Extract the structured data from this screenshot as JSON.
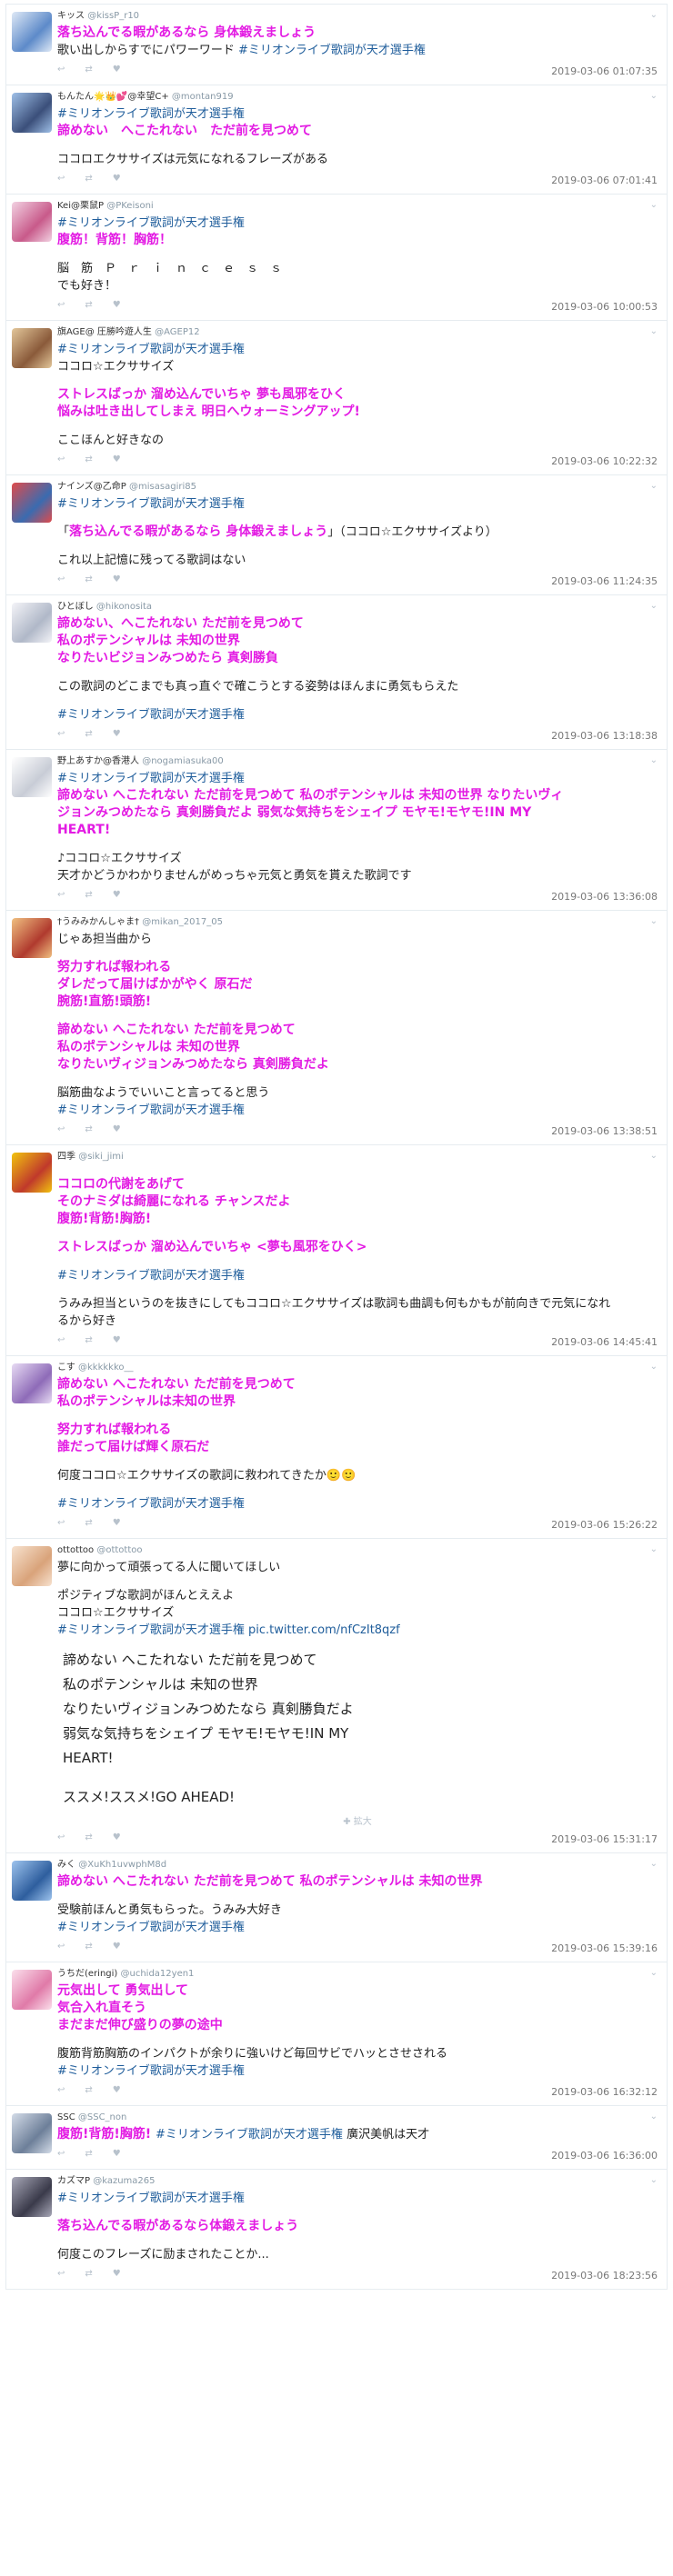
{
  "tweets": [
    {
      "name": "キッス",
      "handle": "@kissP_r10",
      "time": "2019-03-06 01:07:35",
      "avatar": "#5d8ac9",
      "avatar2": "#dfe9f6",
      "lines": [
        {
          "t": "落ち込んでる暇があるなら 身体鍛えましょう",
          "s": "b"
        },
        {
          "segs": [
            {
              "t": "歌い出しからすでにパワーワード ",
              "s": ""
            },
            {
              "t": "#ミリオンライブ歌詞が天才選手権",
              "s": "h"
            }
          ]
        }
      ]
    },
    {
      "name": "もんたん🌟👑💕@幸望C+",
      "handle": "@montan919",
      "time": "2019-03-06 07:01:41",
      "avatar": "#3b4f7a",
      "avatar2": "#9fc0e8",
      "lines": [
        {
          "t": "#ミリオンライブ歌詞が天才選手権",
          "s": "h"
        },
        {
          "t": "諦めない　へこたれない　ただ前を見つめて",
          "s": "b"
        },
        {
          "t": "",
          "s": "gap"
        },
        {
          "t": "ココロエクササイズは元気になれるフレーズがある",
          "s": ""
        }
      ]
    },
    {
      "name": "Kei@栗鼠P",
      "handle": "@PKeisoni",
      "time": "2019-03-06 10:00:53",
      "avatar": "#c85a8a",
      "avatar2": "#f2d2e2",
      "lines": [
        {
          "t": "#ミリオンライブ歌詞が天才選手権",
          "s": "h"
        },
        {
          "t": "腹筋！背筋！胸筋！",
          "s": "b"
        },
        {
          "t": "",
          "s": "gap"
        },
        {
          "t": "脳　筋　Ｐ　ｒ　ｉ　ｎ　ｃ　ｅ　ｓ　ｓ",
          "s": ""
        },
        {
          "t": "でも好き！",
          "s": ""
        }
      ]
    },
    {
      "name": "旗AGE@ 圧勝吟遊人生",
      "handle": "@AGEP12",
      "time": "2019-03-06 10:22:32",
      "avatar": "#8a5a3a",
      "avatar2": "#e3c79a",
      "lines": [
        {
          "t": "#ミリオンライブ歌詞が天才選手権",
          "s": "h"
        },
        {
          "t": "ココロ☆エクササイズ",
          "s": ""
        },
        {
          "t": "",
          "s": "gap"
        },
        {
          "t": "ストレスばっか 溜め込んでいちゃ 夢も風邪をひく",
          "s": "b"
        },
        {
          "t": "悩みは吐き出してしまえ 明日へウォーミングアップ!",
          "s": "b"
        },
        {
          "t": "",
          "s": "gap"
        },
        {
          "t": "ここほんと好きなの",
          "s": ""
        }
      ]
    },
    {
      "name": "ナインズ@乙命P",
      "handle": "@misasagiri85",
      "time": "2019-03-06 11:24:35",
      "avatar": "#3a6bb0",
      "avatar2": "#e04b4b",
      "lines": [
        {
          "t": "#ミリオンライブ歌詞が天才選手権",
          "s": "h"
        },
        {
          "t": "",
          "s": "gap"
        },
        {
          "segs": [
            {
              "t": "「",
              "s": ""
            },
            {
              "t": "落ち込んでる暇があるなら 身体鍛えましょう",
              "s": "b"
            },
            {
              "t": "」（ココロ☆エクササイズより）",
              "s": ""
            }
          ]
        },
        {
          "t": "",
          "s": "gap"
        },
        {
          "t": "これ以上記憶に残ってる歌詞はない",
          "s": ""
        }
      ]
    },
    {
      "name": "ひとぼし",
      "handle": "@hikonosita",
      "time": "2019-03-06 13:18:38",
      "avatar": "#b0b8c8",
      "avatar2": "#f4f4f8",
      "lines": [
        {
          "t": "諦めない、へこたれない ただ前を見つめて",
          "s": "b"
        },
        {
          "t": "私のポテンシャルは 未知の世界",
          "s": "b"
        },
        {
          "t": "なりたいビジョンみつめたら 真剣勝負",
          "s": "b"
        },
        {
          "t": "",
          "s": "gap"
        },
        {
          "t": "この歌詞のどこまでも真っ直ぐで確こうとする姿勢はほんまに勇気もらえた",
          "s": ""
        },
        {
          "t": "",
          "s": "gap"
        },
        {
          "t": " #ミリオンライブ歌詞が天才選手権",
          "s": "h"
        }
      ]
    },
    {
      "name": "野上あすか@香港人",
      "handle": "@nogamiasuka00",
      "time": "2019-03-06 13:36:08",
      "avatar": "#c8ccd6",
      "avatar2": "#ffffff",
      "lines": [
        {
          "t": "#ミリオンライブ歌詞が天才選手権",
          "s": "h"
        },
        {
          "t": "諦めない へこたれない ただ前を見つめて 私のポテンシャルは 未知の世界 なりたいヴィ",
          "s": "b"
        },
        {
          "t": "ジョンみつめたなら 真剣勝負だよ 弱気な気持ちをシェイプ モヤモ!モヤモ!IN MY",
          "s": "b"
        },
        {
          "t": "HEART!",
          "s": "b"
        },
        {
          "t": "",
          "s": "gap"
        },
        {
          "t": "♪ココロ☆エクササイズ",
          "s": ""
        },
        {
          "t": "天才かどうかわかりませんがめっちゃ元気と勇気を貰えた歌詞です",
          "s": ""
        }
      ]
    },
    {
      "name": "†うみみかんしゃま†",
      "handle": "@mikan_2017_05",
      "time": "2019-03-06 13:38:51",
      "avatar": "#b03a2e",
      "avatar2": "#f0c080",
      "lines": [
        {
          "t": "じゃあ担当曲から",
          "s": ""
        },
        {
          "t": "",
          "s": "gap"
        },
        {
          "t": "努力すれば報われる",
          "s": "b"
        },
        {
          "t": "ダレだって届けばかがやく 原石だ",
          "s": "b"
        },
        {
          "t": "腕筋!直筋!頭筋!",
          "s": "b"
        },
        {
          "t": "",
          "s": "gap"
        },
        {
          "t": "諦めない へこたれない ただ前を見つめて",
          "s": "b"
        },
        {
          "t": "私のポテンシャルは 未知の世界",
          "s": "b"
        },
        {
          "t": "なりたいヴィジョンみつめたなら 真剣勝負だよ",
          "s": "b"
        },
        {
          "t": "",
          "s": "gap"
        },
        {
          "t": "脳筋曲なようでいいこと言ってると思う",
          "s": ""
        },
        {
          "t": "#ミリオンライブ歌詞が天才選手権",
          "s": "h"
        }
      ]
    },
    {
      "name": "四季",
      "handle": "@siki_jimi",
      "time": "2019-03-06 14:45:41",
      "avatar": "#c0392b",
      "avatar2": "#f1c40f",
      "lines": [
        {
          "t": "",
          "s": "gap"
        },
        {
          "t": "ココロの代謝をあげて",
          "s": "b"
        },
        {
          "t": "そのナミダは綺麗になれる チャンスだよ",
          "s": "b"
        },
        {
          "t": "腹筋!背筋!胸筋!",
          "s": "b"
        },
        {
          "t": "",
          "s": "gap"
        },
        {
          "t": "ストレスばっか 溜め込んでいちゃ <夢も風邪をひく>",
          "s": "b"
        },
        {
          "t": "",
          "s": "gap"
        },
        {
          "t": "#ミリオンライブ歌詞が天才選手権",
          "s": "h"
        },
        {
          "t": "",
          "s": "gap"
        },
        {
          "t": "うみみ担当というのを抜きにしてもココロ☆エクササイズは歌詞も曲調も何もかもが前向きで元気になれ",
          "s": ""
        },
        {
          "t": "るから好き",
          "s": ""
        }
      ]
    },
    {
      "name": "こす",
      "handle": "@kkkkkko__",
      "time": "2019-03-06 15:26:22",
      "avatar": "#8e6bb8",
      "avatar2": "#e8dcf4",
      "lines": [
        {
          "t": "諦めない へこたれない ただ前を見つめて",
          "s": "b"
        },
        {
          "t": "私のポテンシャルは未知の世界",
          "s": "b"
        },
        {
          "t": "",
          "s": "gap"
        },
        {
          "t": "努力すれば報われる",
          "s": "b"
        },
        {
          "t": "誰だって届けば輝く原石だ",
          "s": "b"
        },
        {
          "t": "",
          "s": "gap"
        },
        {
          "t": "何度ココロ☆エクササイズの歌詞に救われてきたか🙂🙂",
          "s": ""
        },
        {
          "t": "",
          "s": "gap"
        },
        {
          "t": " #ミリオンライブ歌詞が天才選手権",
          "s": "h"
        }
      ]
    },
    {
      "name": "ottottoo",
      "handle": "@ottottoo",
      "time": "2019-03-06 15:31:17",
      "avatar": "#d9a37a",
      "avatar2": "#f7e2cf",
      "lines": [
        {
          "t": "夢に向かって頑張ってる人に聞いてほしい",
          "s": ""
        },
        {
          "t": "",
          "s": "gap"
        },
        {
          "t": "ポジティブな歌詞がほんとええよ",
          "s": ""
        },
        {
          "t": "ココロ☆エクササイズ",
          "s": ""
        },
        {
          "segs": [
            {
              "t": "#ミリオンライブ歌詞が天才選手権 ",
              "s": "h"
            },
            {
              "t": "pic.twitter.com/nfCzIt8qzf",
              "s": "h"
            }
          ]
        }
      ],
      "image_lines": [
        "諦めない へこたれない ただ前を見つめて",
        "私のポテンシャルは 未知の世界",
        "なりたいヴィジョンみつめたなら 真剣勝負だよ",
        "弱気な気持ちをシェイプ モヤモ!モヤモ!IN MY",
        "HEART!",
        "",
        "ススメ!ススメ!GO AHEAD!"
      ],
      "more": "✚ 拡大"
    },
    {
      "name": "みく",
      "handle": "@XuKh1uvwphM8d",
      "time": "2019-03-06 15:39:16",
      "avatar": "#2e5e9e",
      "avatar2": "#9ec4ee",
      "lines": [
        {
          "t": "諦めない へこたれない ただ前を見つめて 私のポテンシャルは 未知の世界",
          "s": "b"
        },
        {
          "t": "",
          "s": "gap"
        },
        {
          "t": "受験前ほんと勇気もらった。うみみ大好き",
          "s": ""
        },
        {
          "t": " #ミリオンライブ歌詞が天才選手権",
          "s": "h"
        }
      ]
    },
    {
      "name": "うちだ(eringi)",
      "handle": "@uchida12yen1",
      "time": "2019-03-06 16:32:12",
      "avatar": "#e07aa8",
      "avatar2": "#fbe0ec",
      "lines": [
        {
          "t": "元気出して 勇気出して",
          "s": "b"
        },
        {
          "t": "気合入れ直そう",
          "s": "b"
        },
        {
          "t": "まだまだ伸び盛りの夢の途中",
          "s": "b"
        },
        {
          "t": "",
          "s": "gap"
        },
        {
          "t": "腹筋背筋胸筋のインパクトが余りに強いけど毎回サビでハッとさせされる",
          "s": ""
        },
        {
          "t": " #ミリオンライブ歌詞が天才選手権",
          "s": "h"
        }
      ]
    },
    {
      "name": "SSC",
      "handle": "@SSC_non",
      "time": "2019-03-06 16:36:00",
      "avatar": "#6d7f99",
      "avatar2": "#d4dce8",
      "lines": [
        {
          "segs": [
            {
              "t": "腹筋!背筋!胸筋! ",
              "s": "b"
            },
            {
              "t": "#ミリオンライブ歌詞が天才選手権",
              "s": "h"
            },
            {
              "t": " 廣沢美帆は天才",
              "s": ""
            }
          ]
        }
      ]
    },
    {
      "name": "カズマP",
      "handle": "@kazuma265",
      "time": "2019-03-06 18:23:56",
      "avatar": "#3a3a4a",
      "avatar2": "#a8a8b8",
      "lines": [
        {
          "t": "#ミリオンライブ歌詞が天才選手権",
          "s": "h"
        },
        {
          "t": "",
          "s": "gap"
        },
        {
          "t": "落ち込んでる暇があるなら体鍛えましょう",
          "s": "b"
        },
        {
          "t": "",
          "s": "gap"
        },
        {
          "t": "何度このフレーズに励まされたことか...",
          "s": ""
        }
      ]
    }
  ]
}
